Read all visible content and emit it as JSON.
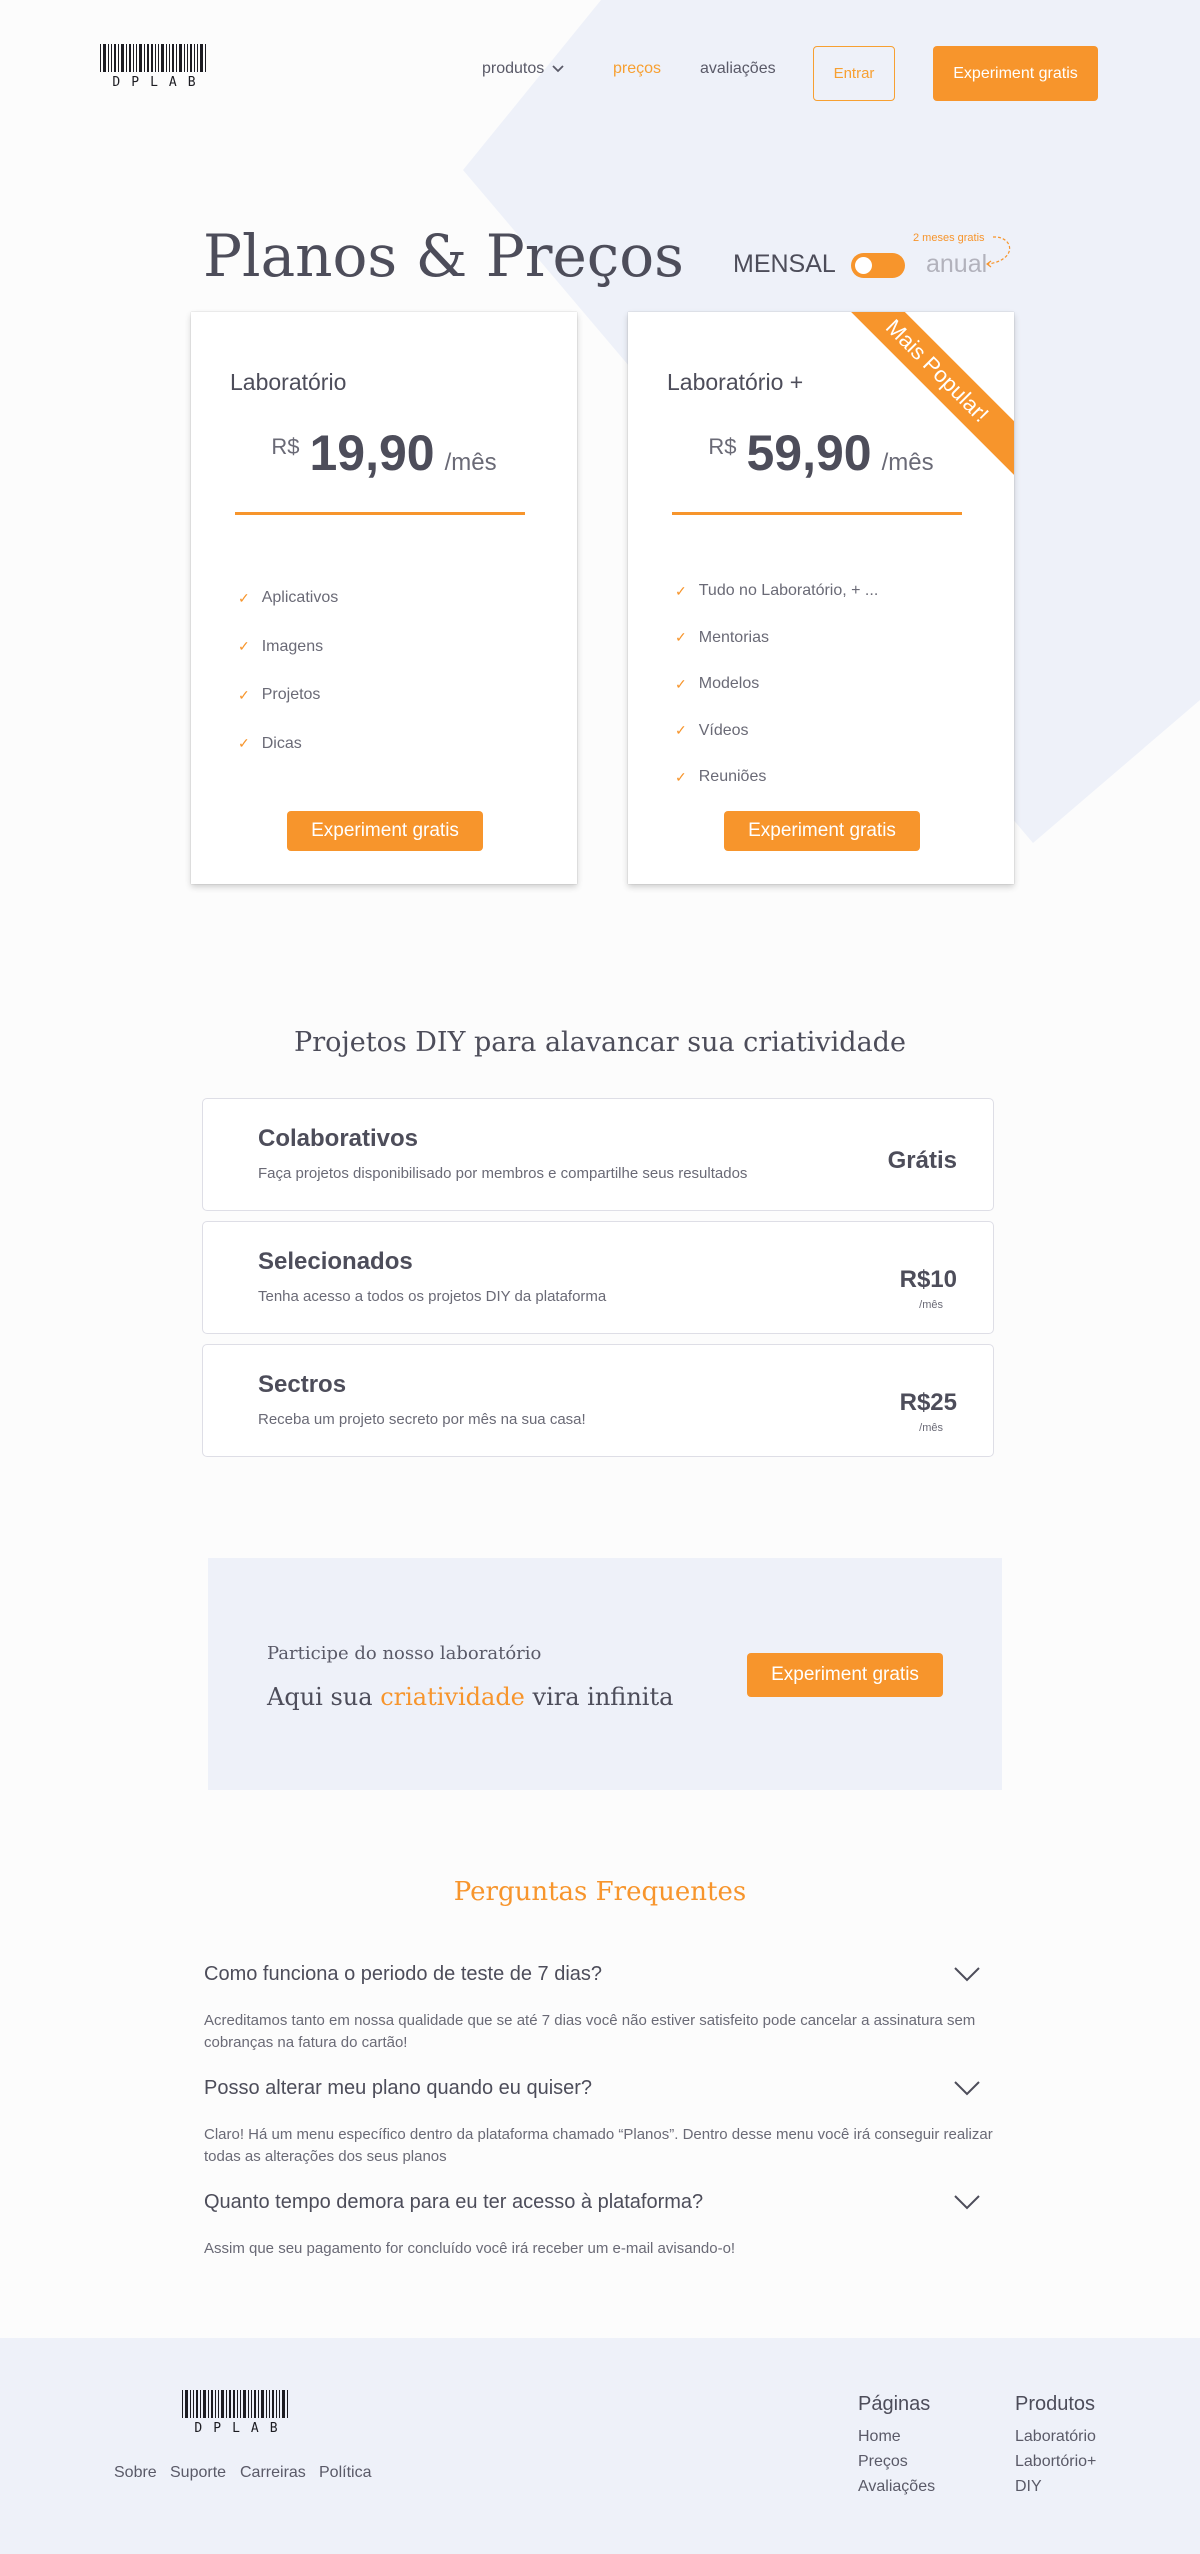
{
  "brand": {
    "logo_text": "DPLAB"
  },
  "nav": {
    "produtos": "produtos",
    "precos": "preços",
    "avaliacoes": "avaliações",
    "login": "Entrar",
    "cta": "Experiment gratis"
  },
  "pricing": {
    "title": "Planos & Preços",
    "monthly": "MENSAL",
    "annual": "anual",
    "promo": "2 meses gratis",
    "plans": [
      {
        "name": "Laboratório",
        "currency": "R$",
        "price": "19,90",
        "period": "/mês",
        "features": [
          "Aplicativos",
          "Imagens",
          "Projetos",
          "Dicas"
        ],
        "cta": "Experiment gratis"
      },
      {
        "name": "Laboratório +",
        "currency": "R$",
        "price": "59,90",
        "period": "/mês",
        "ribbon": "Mais Popular!",
        "features": [
          "Tudo no Laboratório, + ...",
          "Mentorias",
          "Modelos",
          "Vídeos",
          "Reuniões"
        ],
        "cta": "Experiment gratis"
      }
    ]
  },
  "diy": {
    "title": "Projetos DIY para alavancar sua criatividade",
    "rows": [
      {
        "title": "Colaborativos",
        "desc": "Faça projetos disponibilisado por membros e compartilhe seus resultados",
        "price": "Grátis",
        "period": ""
      },
      {
        "title": "Selecionados",
        "desc": "Tenha acesso a todos os projetos DIY da plataforma",
        "price": "R$10",
        "period": "/mês"
      },
      {
        "title": "Sectros",
        "desc": "Receba um projeto secreto por mês na sua casa!",
        "price": "R$25",
        "period": "/mês"
      }
    ]
  },
  "cta_banner": {
    "kicker": "Participe do nosso laboratório",
    "line_before": "Aqui sua",
    "line_accent": "criatividade",
    "line_after": "vira infinita",
    "button": "Experiment gratis"
  },
  "faq": {
    "title": "Perguntas Frequentes",
    "items": [
      {
        "q": "Como funciona o periodo de teste de 7 dias?",
        "a": "Acreditamos tanto em nossa qualidade que se até 7 dias você não estiver satisfeito pode cancelar a assinatura sem cobranças na fatura do cartão!"
      },
      {
        "q": "Posso alterar meu plano quando eu quiser?",
        "a": "Claro! Há um menu específico dentro da plataforma chamado “Planos”. Dentro desse menu você irá conseguir realizar todas as alterações dos seus planos"
      },
      {
        "q": "Quanto tempo demora para eu ter acesso à plataforma?",
        "a": "Assim que seu pagamento for concluído você irá receber um e-mail avisando-o!"
      }
    ]
  },
  "footer": {
    "links": [
      "Sobre",
      "Suporte",
      "Carreiras",
      "Política"
    ],
    "pages": {
      "title": "Páginas",
      "items": [
        "Home",
        "Preços",
        "Avaliações"
      ]
    },
    "products": {
      "title": "Produtos",
      "items": [
        "Laboratório",
        "Labortório+",
        "DIY"
      ]
    }
  },
  "colors": {
    "accent": "#f7952c",
    "text": "#4d4d5a",
    "panel": "#eef1f9"
  },
  "icons": [
    "chevron-down-icon",
    "check-icon",
    "barcode-logo-icon"
  ]
}
